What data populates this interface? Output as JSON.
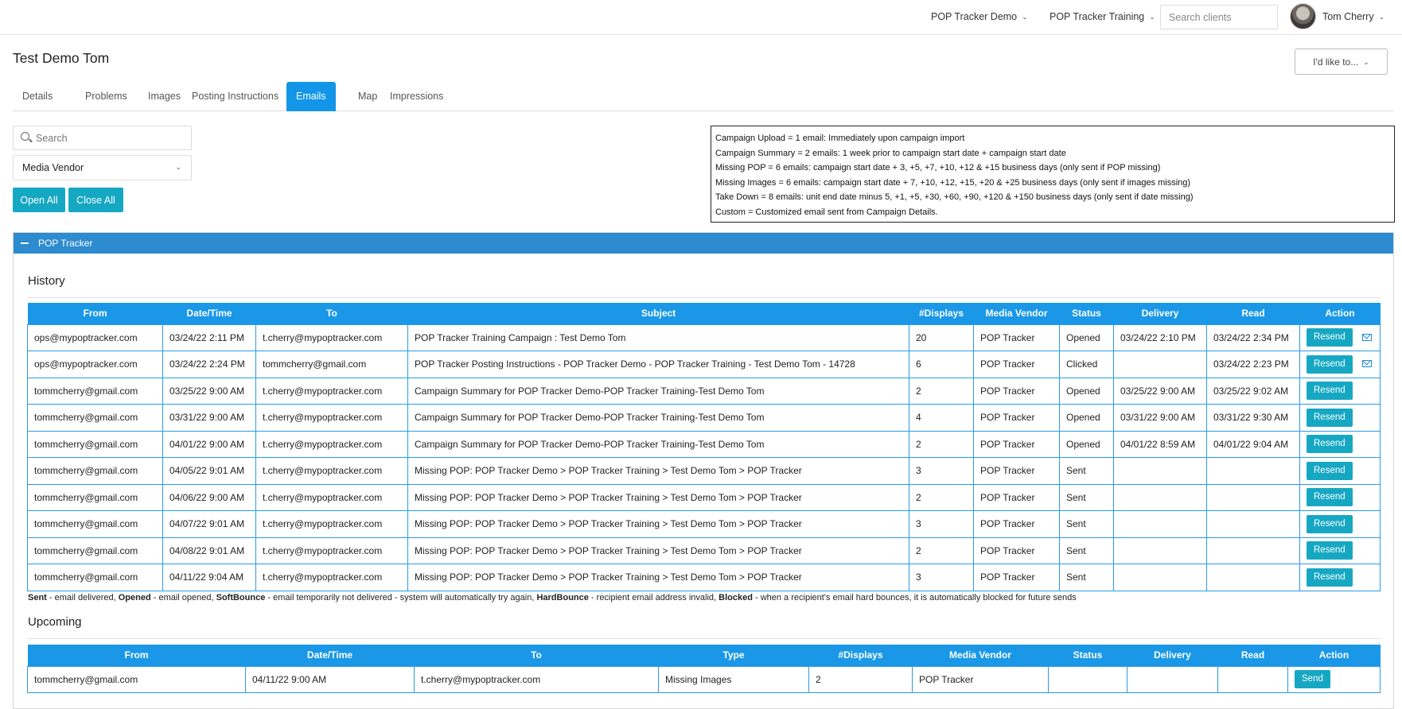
{
  "topnav": {
    "account_dropdown": "POP Tracker Demo",
    "campaign_dropdown": "POP Tracker Training",
    "search_placeholder": "Search clients",
    "user_name": "Tom Cherry"
  },
  "header": {
    "title": "Test Demo Tom",
    "action_menu": "I'd like to..."
  },
  "tabs": [
    {
      "label": "Details"
    },
    {
      "label": "Problems"
    },
    {
      "label": "Images"
    },
    {
      "label": "Posting Instructions"
    },
    {
      "label": "Emails",
      "active": true
    },
    {
      "label": "Map"
    },
    {
      "label": "Impressions"
    }
  ],
  "filters": {
    "search_placeholder": "Search",
    "vendor_selected": "Media Vendor",
    "open_all": "Open All",
    "close_all": "Close All"
  },
  "legend_lines": [
    "Campaign Upload = 1 email: Immediately upon campaign import",
    "Campaign Summary = 2 emails: 1 week prior to campaign start date + campaign start date",
    "Missing POP = 6 emails: campaign start date + 3, +5, +7, +10, +12 & +15 business days (only sent if POP missing)",
    "Missing Images = 6 emails: campaign start date + 7, +10, +12, +15, +20 & +25 business days (only sent if images missing)",
    "Take Down = 8 emails: unit end date minus 5, +1, +5, +30, +60, +90, +120 & +150 business days (only sent if date missing)",
    "Custom = Customized email sent from Campaign Details."
  ],
  "panel": {
    "title": "POP Tracker",
    "history_title": "History",
    "upcoming_title": "Upcoming",
    "history_headers": [
      "From",
      "Date/Time",
      "To",
      "Subject",
      "#Displays",
      "Media Vendor",
      "Status",
      "Delivery",
      "Read",
      "Action"
    ],
    "history_rows": [
      {
        "from": "ops@mypoptracker.com",
        "datetime": "03/24/22 2:11 PM",
        "to": "t.cherry@mypoptracker.com",
        "subject": "POP Tracker Training Campaign : Test Demo Tom",
        "displays": "20",
        "vendor": "POP Tracker",
        "status": "Opened",
        "delivery": "03/24/22 2:10 PM",
        "read": "03/24/22 2:34 PM",
        "action": "Resend",
        "mail_icon": true
      },
      {
        "from": "ops@mypoptracker.com",
        "datetime": "03/24/22 2:24 PM",
        "to": "tommcherry@gmail.com",
        "subject": "POP Tracker Posting Instructions - POP Tracker Demo - POP Tracker Training - Test Demo Tom - 14728",
        "displays": "6",
        "vendor": "POP Tracker",
        "status": "Clicked",
        "delivery": "",
        "read": "03/24/22 2:23 PM",
        "action": "Resend",
        "mail_icon": true
      },
      {
        "from": "tommcherry@gmail.com",
        "datetime": "03/25/22 9:00 AM",
        "to": "t.cherry@mypoptracker.com",
        "subject": "Campaign Summary for POP Tracker Demo-POP Tracker Training-Test Demo Tom",
        "displays": "2",
        "vendor": "POP Tracker",
        "status": "Opened",
        "delivery": "03/25/22 9:00 AM",
        "read": "03/25/22 9:02 AM",
        "action": "Resend",
        "mail_icon": false
      },
      {
        "from": "tommcherry@gmail.com",
        "datetime": "03/31/22 9:00 AM",
        "to": "t.cherry@mypoptracker.com",
        "subject": "Campaign Summary for POP Tracker Demo-POP Tracker Training-Test Demo Tom",
        "displays": "4",
        "vendor": "POP Tracker",
        "status": "Opened",
        "delivery": "03/31/22 9:00 AM",
        "read": "03/31/22 9:30 AM",
        "action": "Resend",
        "mail_icon": false
      },
      {
        "from": "tommcherry@gmail.com",
        "datetime": "04/01/22 9:00 AM",
        "to": "t.cherry@mypoptracker.com",
        "subject": "Campaign Summary for POP Tracker Demo-POP Tracker Training-Test Demo Tom",
        "displays": "2",
        "vendor": "POP Tracker",
        "status": "Opened",
        "delivery": "04/01/22 8:59 AM",
        "read": "04/01/22 9:04 AM",
        "action": "Resend",
        "mail_icon": false
      },
      {
        "from": "tommcherry@gmail.com",
        "datetime": "04/05/22 9:01 AM",
        "to": "t.cherry@mypoptracker.com",
        "subject": "Missing POP: POP Tracker Demo > POP Tracker Training > Test Demo Tom > POP Tracker",
        "displays": "3",
        "vendor": "POP Tracker",
        "status": "Sent",
        "delivery": "",
        "read": "",
        "action": "Resend",
        "mail_icon": false
      },
      {
        "from": "tommcherry@gmail.com",
        "datetime": "04/06/22 9:00 AM",
        "to": "t.cherry@mypoptracker.com",
        "subject": "Missing POP: POP Tracker Demo > POP Tracker Training > Test Demo Tom > POP Tracker",
        "displays": "2",
        "vendor": "POP Tracker",
        "status": "Sent",
        "delivery": "",
        "read": "",
        "action": "Resend",
        "mail_icon": false
      },
      {
        "from": "tommcherry@gmail.com",
        "datetime": "04/07/22 9:01 AM",
        "to": "t.cherry@mypoptracker.com",
        "subject": "Missing POP: POP Tracker Demo > POP Tracker Training > Test Demo Tom > POP Tracker",
        "displays": "3",
        "vendor": "POP Tracker",
        "status": "Sent",
        "delivery": "",
        "read": "",
        "action": "Resend",
        "mail_icon": false
      },
      {
        "from": "tommcherry@gmail.com",
        "datetime": "04/08/22 9:01 AM",
        "to": "t.cherry@mypoptracker.com",
        "subject": "Missing POP: POP Tracker Demo > POP Tracker Training > Test Demo Tom > POP Tracker",
        "displays": "2",
        "vendor": "POP Tracker",
        "status": "Sent",
        "delivery": "",
        "read": "",
        "action": "Resend",
        "mail_icon": false
      },
      {
        "from": "tommcherry@gmail.com",
        "datetime": "04/11/22 9:04 AM",
        "to": "t.cherry@mypoptracker.com",
        "subject": "Missing POP: POP Tracker Demo > POP Tracker Training > Test Demo Tom > POP Tracker",
        "displays": "3",
        "vendor": "POP Tracker",
        "status": "Sent",
        "delivery": "",
        "read": "",
        "action": "Resend",
        "mail_icon": false
      }
    ],
    "status_legend": [
      {
        "term": "Sent",
        "desc": " - email delivered, "
      },
      {
        "term": "Opened",
        "desc": " - email opened, "
      },
      {
        "term": "SoftBounce",
        "desc": " - email temporarily not delivered - system will automatically try again, "
      },
      {
        "term": "HardBounce",
        "desc": " - recipient email address invalid, "
      },
      {
        "term": "Blocked",
        "desc": " - when a recipient's email hard bounces, it is automatically blocked for future sends"
      }
    ],
    "upcoming_headers": [
      "From",
      "Date/Time",
      "To",
      "Type",
      "#Displays",
      "Media Vendor",
      "Status",
      "Delivery",
      "Read",
      "Action"
    ],
    "upcoming_rows": [
      {
        "from": "tommcherry@gmail.com",
        "datetime": "04/11/22 9:00 AM",
        "to": "t.cherry@mypoptracker.com",
        "type": "Missing Images",
        "displays": "2",
        "vendor": "POP Tracker",
        "status": "",
        "delivery": "",
        "read": "",
        "action": "Send"
      }
    ]
  },
  "colors": {
    "tab_active": "#1396e8",
    "table_header": "#1a98e7",
    "panel_header": "#2d8bcf",
    "button_teal": "#16a8c3"
  }
}
